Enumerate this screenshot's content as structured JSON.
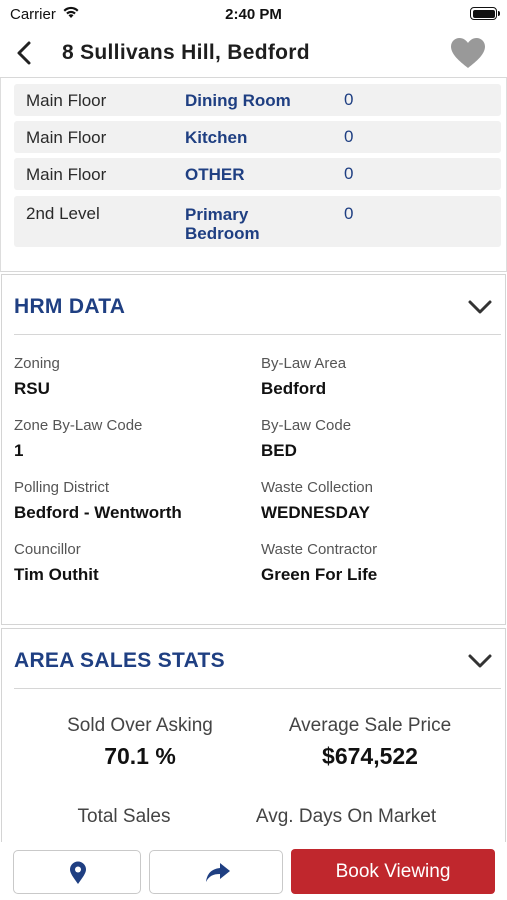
{
  "status_bar": {
    "carrier": "Carrier",
    "time": "2:40 PM"
  },
  "nav": {
    "title": "8 Sullivans Hill, Bedford"
  },
  "rooms": [
    {
      "level": "Main Floor",
      "name": "Dining Room",
      "value": "0"
    },
    {
      "level": "Main Floor",
      "name": "Kitchen",
      "value": "0"
    },
    {
      "level": "Main Floor",
      "name": "OTHER",
      "value": "0"
    },
    {
      "level": "2nd Level",
      "name": "Primary Bedroom",
      "value": "0"
    }
  ],
  "hrm": {
    "title": "HRM DATA",
    "fields": [
      {
        "label": "Zoning",
        "value": "RSU"
      },
      {
        "label": "By-Law Area",
        "value": "Bedford"
      },
      {
        "label": "Zone By-Law Code",
        "value": "1"
      },
      {
        "label": "By-Law Code",
        "value": "BED"
      },
      {
        "label": "Polling District",
        "value": "Bedford - Wentworth"
      },
      {
        "label": "Waste Collection",
        "value": "WEDNESDAY"
      },
      {
        "label": "Councillor",
        "value": "Tim Outhit"
      },
      {
        "label": "Waste Contractor",
        "value": "Green For Life"
      }
    ]
  },
  "sales": {
    "title": "AREA SALES STATS",
    "stats": [
      {
        "label": "Sold Over Asking",
        "value": "70.1 %"
      },
      {
        "label": "Average Sale Price",
        "value": "$674,522"
      },
      {
        "label": "Total Sales",
        "value": ""
      },
      {
        "label": "Avg. Days On Market",
        "value": ""
      }
    ]
  },
  "bottom": {
    "map_icon": "map-pin-icon",
    "share_icon": "share-arrow-icon",
    "book_label": "Book Viewing"
  },
  "colors": {
    "accent_blue": "#1f3f82",
    "book_red": "#c0272d"
  }
}
